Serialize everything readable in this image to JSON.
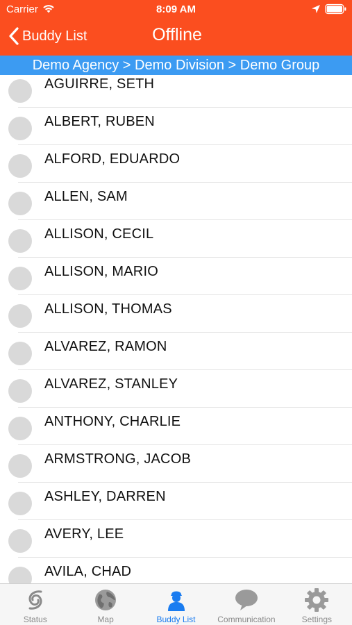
{
  "status_bar": {
    "carrier": "Carrier",
    "time": "8:09 AM",
    "wifi_icon": "wifi-icon",
    "location_icon": "location-arrow-icon",
    "battery_icon": "battery-icon"
  },
  "nav_bar": {
    "back_label": "Buddy List",
    "back_icon": "chevron-left-icon",
    "title": "Offline",
    "color": "#fb4e1f"
  },
  "breadcrumb": {
    "text": "Demo Agency > Demo Division > Demo Group",
    "color": "#3c9bf2"
  },
  "buddies": [
    "AGUIRRE, SETH",
    "ALBERT, RUBEN",
    "ALFORD, EDUARDO",
    "ALLEN, SAM",
    "ALLISON, CECIL",
    "ALLISON, MARIO",
    "ALLISON, THOMAS",
    "ALVAREZ, RAMON",
    "ALVAREZ, STANLEY",
    "ANTHONY, CHARLIE",
    "ARMSTRONG, JACOB",
    "ASHLEY, DARREN",
    "AVERY, LEE",
    "AVILA, CHAD"
  ],
  "tab_bar": {
    "active_color": "#1a7cf0",
    "tabs": [
      {
        "label": "Status",
        "icon": "status-swirl-icon",
        "active": false
      },
      {
        "label": "Map",
        "icon": "globe-icon",
        "active": false
      },
      {
        "label": "Buddy List",
        "icon": "person-icon",
        "active": true
      },
      {
        "label": "Communication",
        "icon": "speech-bubble-icon",
        "active": false
      },
      {
        "label": "Settings",
        "icon": "gear-icon",
        "active": false
      }
    ]
  }
}
